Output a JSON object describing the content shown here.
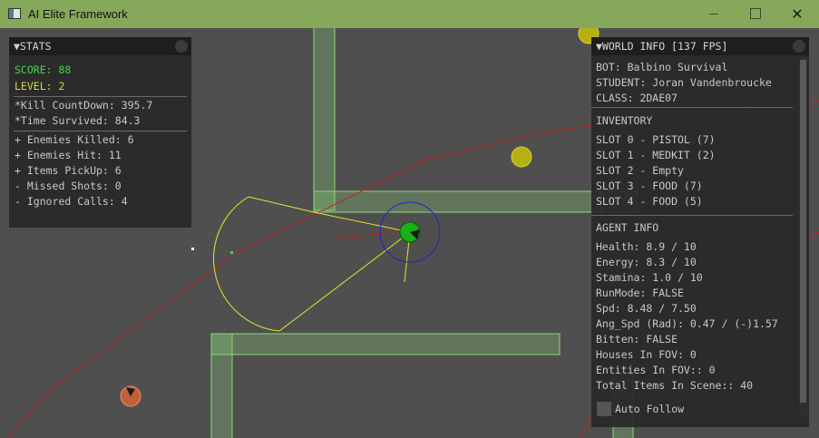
{
  "window": {
    "title": "AI Elite Framework",
    "minimize": "—",
    "maximize": "☐",
    "close": "✕"
  },
  "stats_panel": {
    "title": "▼STATS",
    "score": "SCORE: 88",
    "level": "LEVEL: 2",
    "kill_countdown": "*Kill CountDown: 395.7",
    "time_survived": "*Time Survived: 84.3",
    "enemies_killed": "+ Enemies Killed: 6",
    "enemies_hit": "+ Enemies Hit: 11",
    "items_pickup": "+ Items PickUp: 6",
    "missed_shots": "- Missed Shots: 0",
    "ignored_calls": "- Ignored Calls: 4"
  },
  "world_panel": {
    "title": "▼WORLD INFO [137 FPS]",
    "bot": "BOT: Balbino Survival",
    "student": "STUDENT: Joran Vandenbroucke",
    "class": "CLASS: 2DAE07",
    "inventory_header": "INVENTORY",
    "slots": [
      "SLOT 0 - PISTOL (7)",
      "SLOT 1 - MEDKIT (2)",
      "SLOT 2 - Empty",
      "SLOT 3 - FOOD (7)",
      "SLOT 4 - FOOD (5)"
    ],
    "agent_header": "AGENT INFO",
    "health": "Health: 8.9 / 10",
    "energy": "Energy: 8.3 / 10",
    "stamina": "Stamina: 1.0 / 10",
    "runmode": "RunMode: FALSE",
    "spd": "Spd: 8.48 / 7.50",
    "ang_spd": "Ang_Spd (Rad): 0.47 / (-)1.57",
    "bitten": "Bitten: FALSE",
    "houses_fov": "Houses In FOV: 0",
    "entities_fov": "Entities In FOV:: 0",
    "total_items": "Total Items In Scene:: 40",
    "auto_follow": "Auto Follow"
  },
  "colors": {
    "titlebar": "#86a85a",
    "world_bg": "#4f4f4f",
    "house_outline": "#8ed67a",
    "score_green": "#4cd04c",
    "level_yellow": "#d6d646",
    "agent_green": "#19b019",
    "fov_yellow": "#e6e622",
    "path_red": "#c42222",
    "item_yellow": "#b6b012",
    "enemy_orange": "#c0603a"
  }
}
